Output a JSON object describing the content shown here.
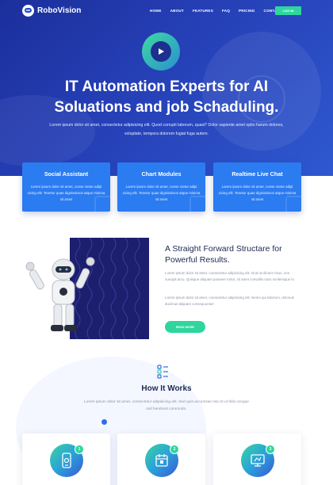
{
  "brand": {
    "name": "RoboVision"
  },
  "nav": {
    "items": [
      "HOME",
      "ABOUT",
      "FEATURES",
      "FAQ",
      "PRICING",
      "CONTACT"
    ],
    "login_label": "LOG IN"
  },
  "hero": {
    "title_line1": "IT Automation Experts for AI",
    "title_line2": "Soluations and job Schaduling.",
    "subtitle": "Lorem ipsum dolor sit amet, consectetur adipisicing elit. Quod corrupti laborum, quasi? Dolor sapiente amet optio harum dolores, voluptate, tempora dolorem fugiat fuga autem.",
    "play_icon": "play-icon"
  },
  "features": [
    {
      "title": "Social Assistant",
      "desc": "Lorem ipsum dolor sit amet, conse ctetur adipi sicing elit. Tenetur quae dignissimos atque minima sit amet"
    },
    {
      "title": "Chart Modules",
      "desc": "Lorem ipsum dolor sit amet, conse ctetur adipi sicing elit. Tenetur quae dignissimos atque minima sit amet"
    },
    {
      "title": "Realtime Live Chat",
      "desc": "Lorem ipsum dolor sit amet, conse ctetur adipi sicing elit. Tenetur quae dignissimos atque minima sit amet"
    }
  ],
  "about": {
    "title": "A Straight Forward Structare for Powerful Results.",
    "p1": "Lorem ipsum dolor sit amet, consectetur adipisicing elit. Duis at dictum risus, non suscipit arcu. Quisque aliquam posuere tortor, sit amet convallis nunc scelerisque in.",
    "p2": "Lorem ipsum dolor sit amet, consectetur adipisicing elit. Nemo qui laborum, dolorum ducimus aliquam consequuntur!",
    "button": "READ MORE"
  },
  "how": {
    "title": "How It Works",
    "subtitle": "Lorem ipsum dolor sit amet, consectetur adipisicing elit. Sed quis accumsan nisi Ut ut felis congue nisl hendrerit commodo.",
    "steps": [
      {
        "num": "1",
        "icon": "phone-settings-icon"
      },
      {
        "num": "2",
        "icon": "calendar-icon"
      },
      {
        "num": "3",
        "icon": "monitor-icon"
      }
    ]
  },
  "colors": {
    "hero": "#2640b7",
    "card": "#2b7bf1",
    "accent": "#2ed69d",
    "heading": "#1d2a52"
  }
}
